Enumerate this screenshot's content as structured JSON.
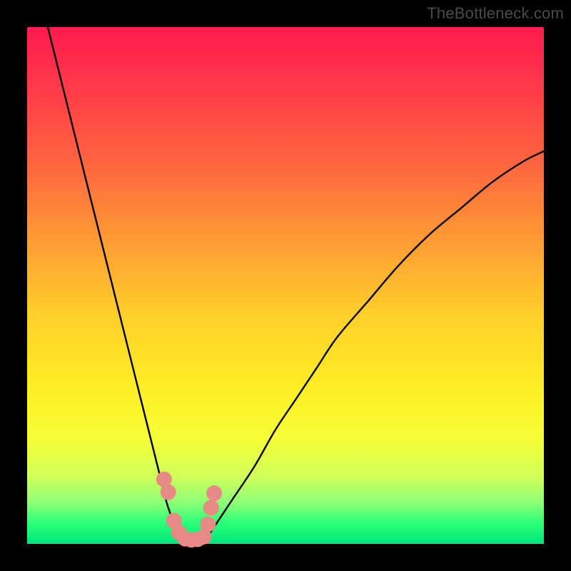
{
  "watermark": "TheBottleneck.com",
  "chart_data": {
    "type": "line",
    "title": "",
    "xlabel": "",
    "ylabel": "",
    "xlim": [
      0,
      100
    ],
    "ylim": [
      0,
      100
    ],
    "grid": false,
    "legend": false,
    "annotations": [],
    "background": {
      "gradient": "vertical",
      "stops": [
        {
          "pos": 0.0,
          "color": "#ff1a4f"
        },
        {
          "pos": 0.12,
          "color": "#ff3b49"
        },
        {
          "pos": 0.28,
          "color": "#ff6a3e"
        },
        {
          "pos": 0.42,
          "color": "#ff9e34"
        },
        {
          "pos": 0.56,
          "color": "#ffd02a"
        },
        {
          "pos": 0.7,
          "color": "#ffee25"
        },
        {
          "pos": 0.8,
          "color": "#f5ff38"
        },
        {
          "pos": 0.87,
          "color": "#d0ff5a"
        },
        {
          "pos": 0.92,
          "color": "#8dff77"
        },
        {
          "pos": 0.96,
          "color": "#2bff7a"
        },
        {
          "pos": 1.0,
          "color": "#00e47a"
        }
      ],
      "note": "gradient encodes score: bottom (green) = no bottleneck, top (red) = severe bottleneck"
    },
    "series": [
      {
        "name": "left-curve",
        "color": "#000000",
        "x": [
          4,
          6,
          8,
          10,
          12,
          14,
          16,
          18,
          20,
          22,
          24,
          26,
          27,
          28,
          29,
          30
        ],
        "values": [
          100,
          92,
          84,
          76,
          68,
          60,
          52,
          44,
          36,
          28,
          20,
          12,
          8,
          5,
          2,
          0
        ]
      },
      {
        "name": "right-curve",
        "color": "#000000",
        "x": [
          34,
          36,
          38,
          40,
          44,
          48,
          52,
          56,
          60,
          66,
          72,
          78,
          84,
          90,
          96,
          100
        ],
        "values": [
          0,
          3,
          6,
          9,
          15,
          22,
          28,
          34,
          40,
          47,
          54,
          60,
          65,
          70,
          74,
          76
        ]
      },
      {
        "name": "valley-floor",
        "color": "#000000",
        "x": [
          30,
          31,
          32,
          33,
          34
        ],
        "values": [
          0,
          0,
          0,
          0,
          0
        ]
      }
    ],
    "markers": [
      {
        "name": "valley-dots",
        "color": "#e78a85",
        "shape": "circle",
        "size": 11,
        "x": [
          26.5,
          27.3,
          28.4,
          29.4,
          30.6,
          31.8,
          33.0,
          34.2,
          35.0,
          35.6,
          36.2
        ],
        "values": [
          12.5,
          10.0,
          4.5,
          2.2,
          1.0,
          0.8,
          0.9,
          1.4,
          3.8,
          7.0,
          9.8
        ]
      }
    ],
    "min_x": 32,
    "min_y": 0
  }
}
